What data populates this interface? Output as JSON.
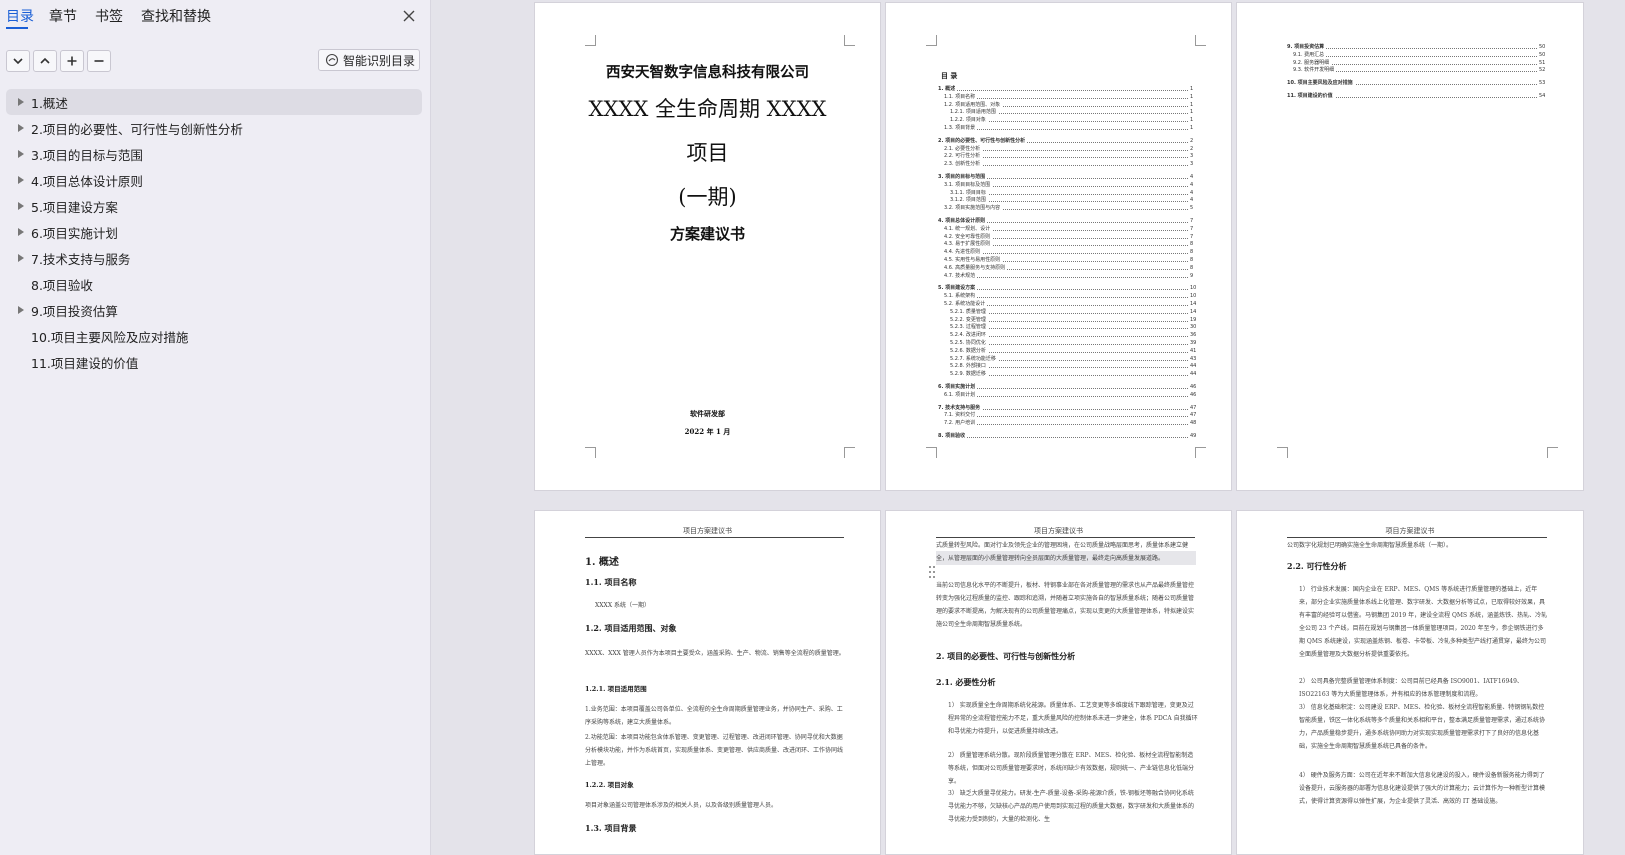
{
  "sidebar": {
    "tabs": [
      {
        "label": "目录",
        "active": true
      },
      {
        "label": "章节",
        "active": false
      },
      {
        "label": "书签",
        "active": false
      },
      {
        "label": "查找和替换",
        "active": false
      }
    ],
    "toolbar": {
      "smart_label": "智能识别目录"
    },
    "toc": [
      {
        "label": "1.概述",
        "expandable": true,
        "active": true
      },
      {
        "label": "2.项目的必要性、可行性与创新性分析",
        "expandable": true,
        "active": false
      },
      {
        "label": "3.项目的目标与范围",
        "expandable": true,
        "active": false
      },
      {
        "label": "4.项目总体设计原则",
        "expandable": true,
        "active": false
      },
      {
        "label": "5.项目建设方案",
        "expandable": true,
        "active": false
      },
      {
        "label": "6.项目实施计划",
        "expandable": true,
        "active": false
      },
      {
        "label": "7.技术支持与服务",
        "expandable": true,
        "active": false
      },
      {
        "label": "8.项目验收",
        "expandable": false,
        "active": false
      },
      {
        "label": "9.项目投资估算",
        "expandable": true,
        "active": false
      },
      {
        "label": "10.项目主要风险及应对措施",
        "expandable": false,
        "active": false
      },
      {
        "label": "11.项目建设的价值",
        "expandable": false,
        "active": false
      }
    ]
  },
  "cover": {
    "company": "西安天智数字信息科技有限公司",
    "title_line1": "XXXX 全生命周期 XXXX",
    "title_line2": "项目",
    "title_line3": "(一期)",
    "subtitle": "方案建议书",
    "dept": "软件研发部",
    "date": "2022 年 1 月"
  },
  "toc_page": {
    "title": "目  录",
    "entries": [
      {
        "label": "1.  概述",
        "page": "1",
        "level": 0
      },
      {
        "label": "1.1.  项目名称",
        "page": "1",
        "level": 1
      },
      {
        "label": "1.2.  项目适用范围、对象",
        "page": "1",
        "level": 1
      },
      {
        "label": "1.2.1.  项目适用范围",
        "page": "1",
        "level": 2
      },
      {
        "label": "1.2.2.  项目对象",
        "page": "1",
        "level": 2
      },
      {
        "label": "1.3.  项目背景",
        "page": "1",
        "level": 1
      },
      {
        "label": "2.  项目的必要性、可行性与创新性分析",
        "page": "2",
        "level": 0
      },
      {
        "label": "2.1.  必要性分析",
        "page": "2",
        "level": 1
      },
      {
        "label": "2.2.  可行性分析",
        "page": "3",
        "level": 1
      },
      {
        "label": "2.3.  创新性分析",
        "page": "3",
        "level": 1
      },
      {
        "label": "3.  项目的目标与范围",
        "page": "4",
        "level": 0
      },
      {
        "label": "3.1.  项目目标及范围",
        "page": "4",
        "level": 1
      },
      {
        "label": "3.1.1.  项目目标",
        "page": "4",
        "level": 2
      },
      {
        "label": "3.1.2.  项目范围",
        "page": "4",
        "level": 2
      },
      {
        "label": "3.2.  项目实施范围与内容",
        "page": "5",
        "level": 1
      },
      {
        "label": "4.  项目总体设计原则",
        "page": "7",
        "level": 0
      },
      {
        "label": "4.1.  统一规划、设计",
        "page": "7",
        "level": 1
      },
      {
        "label": "4.2.  安全可靠性原则",
        "page": "7",
        "level": 1
      },
      {
        "label": "4.3.  易于扩展性原则",
        "page": "8",
        "level": 1
      },
      {
        "label": "4.4.  先进性原则",
        "page": "8",
        "level": 1
      },
      {
        "label": "4.5.  实用性与易用性原则",
        "page": "8",
        "level": 1
      },
      {
        "label": "4.6.  高质量服务与支持原则",
        "page": "8",
        "level": 1
      },
      {
        "label": "4.7.  技术规范",
        "page": "9",
        "level": 1
      },
      {
        "label": "5.  项目建设方案",
        "page": "10",
        "level": 0
      },
      {
        "label": "5.1.  系统架构",
        "page": "10",
        "level": 1
      },
      {
        "label": "5.2.  系统功能设计",
        "page": "14",
        "level": 1
      },
      {
        "label": "5.2.1.  质量管理",
        "page": "14",
        "level": 2
      },
      {
        "label": "5.2.2.  变更管理",
        "page": "19",
        "level": 2
      },
      {
        "label": "5.2.3.  过程管理",
        "page": "30",
        "level": 2
      },
      {
        "label": "5.2.4.  改进闭环",
        "page": "36",
        "level": 2
      },
      {
        "label": "5.2.5.  协同优化",
        "page": "39",
        "level": 2
      },
      {
        "label": "5.2.6.  数据分析",
        "page": "41",
        "level": 2
      },
      {
        "label": "5.2.7.  系统功能迁移",
        "page": "43",
        "level": 2
      },
      {
        "label": "5.2.8.  外部接口",
        "page": "44",
        "level": 2
      },
      {
        "label": "5.2.9.  数据迁移",
        "page": "44",
        "level": 2
      },
      {
        "label": "6.  项目实施计划",
        "page": "46",
        "level": 0
      },
      {
        "label": "6.1.  项目计划",
        "page": "46",
        "level": 1
      },
      {
        "label": "7.  技术支持与服务",
        "page": "47",
        "level": 0
      },
      {
        "label": "7.1.  资料交付",
        "page": "47",
        "level": 1
      },
      {
        "label": "7.2.  用户培训",
        "page": "48",
        "level": 1
      },
      {
        "label": "8.  项目验收",
        "page": "49",
        "level": 0
      }
    ]
  },
  "toc_page2": {
    "entries": [
      {
        "label": "9.  项目投资估算",
        "page": "50",
        "level": 0
      },
      {
        "label": "9.1.  费用汇总",
        "page": "50",
        "level": 1
      },
      {
        "label": "9.2.  服务器明细",
        "page": "51",
        "level": 1
      },
      {
        "label": "9.3.  软件开发明细",
        "page": "52",
        "level": 1
      },
      {
        "label": "10.  项目主要风险及应对措施",
        "page": "53",
        "level": 0
      },
      {
        "label": "11.  项目建设的价值",
        "page": "54",
        "level": 0
      }
    ]
  },
  "body_pages": {
    "header": "项目方案建议书",
    "page4": {
      "h_overview": "1.  概述",
      "h_name": "1.1.  项目名称",
      "p_name": "XXXX 系统（一期）",
      "h_scope": "1.2.  项目适用范围、对象",
      "p_scope": "XXXX、XXX 管理人员作为本项目主要受众，涵盖采购、生产、物流、销售等全流程的质量管理。",
      "h_scope_range": "1.2.1.  项目适用范围",
      "p_range1": "1.业务范围：本项目覆盖公司各单位、全流程的全生命周期质量管理业务，并协同生产、采购、工序采购等系统，建立大质量体系。",
      "p_range2": "2.功能范围：本项目功能包含体系管理、变更管理、过程管理、改进闭环管理、协同寻优和大数据分析模块功能，并作为系统首页，实现质量体系、变更管理、供应商质量、改进闭环、工作协同线上管理。",
      "h_object": "1.2.2.  项目对象",
      "p_object": "项目对象涵盖公司管理体系涉及的相关人员，以及各级别质量管理人员。",
      "h_background": "1.3.  项目背景"
    },
    "page5": {
      "p_intro": "式质量转型风险。面对行业及领先企业的管理困境，在公司质量战略层面思考，质量体系建立健全，从管理层面的小质量管理转向全员层面的大质量管理，最终走向高质量发展道路。",
      "p_current": "当前公司信息化水平的不断提升，板材、特钢事业部在各对质量管理的需求也从产品最终质量管控转变为强化过程质量的监控、跟踪和追溯，并随着立项实施各自的智慧质量系统；随着公司质量管理的要求不断提高，为解决现有的公司质量管理痛点，实现以变更的大质量管理体系，特拟建设实施公司全生命周期智慧质量系统。",
      "h_section2": "2.  项目的必要性、可行性与创新性分析",
      "h_necessity": "2.1.  必要性分析",
      "items": [
        "1） 实现质量全生命周期系统化能源。质量体系、工艺变更等多维度线下跟踪管理，变更及过程异常的全流程管控能力不足，重大质量风险的控制体系未进一步建全，体系 PDCA 自我循环和寻优能力待提升，以促进质量持续改进。",
        "2） 质量管理系统分散。现阶段质量管理分散在 ERP、MES、检化验、板材全流程智能制造等系统，但面对公司质量管理要求时，系统间缺少有效数据，规则统一、产业链信息化低端分享。",
        "3） 缺乏大质量寻优能力。研发-生产-质量-设备-采购-能源介质，铁-钢板坯等融合协同化系统寻优能力不够，欠缺核心产品的用户使用到实现过程的质量大数据，数字研发和大质量体系的寻优能力受到制约，大量的检测化、生"
      ]
    },
    "page6": {
      "p_top": "公司数字化规划已明确实施全生命周期智慧质量系统（一期）。",
      "h_feasibility": "2.2.  可行性分析",
      "items": [
        "1） 行业技术发展：国内企业在 ERP、MES、QMS 等系统进行质量管理的基础上，近年来，部分企业实施质量体系线上化管理、数字研发、大数据分析等试点，已取得较好效果，具有丰富的经验可以借鉴。马钢集团 2019 年，建设全流程 QMS 系统，涵盖炼铁、热轧、冷轧全公司 23 个产线，目前在规划与钢集团一体质量管理项目，2020 年至今，参企钢铁进行多期 QMS 系统建设，实现涵盖炼钢、板卷、卡带板、冷轧多种类型产线打通贯穿，最终为公司全面质量管理及大数据分析提供重要依托。",
        "2） 公司具备完整质量管理体系制度：公司目前已经具备 ISO9001、IATF16949、ISO22163 等为大质量管理体系，并有相应的体系管理制度和流程。",
        "3） 信息化基础积淀：公司建设 ERP、MES、检化验、板材全流程智能质量、特钢钢轧数控智能质量，铁区一体化系统等多个质量和关系相和平台，整本满足质量管理需求，通过系统协力，产品质量稳步提升，通多系统协同助力对实现实现质量管理需求打下了良好的信息化基础，实施全生命周期智慧质量系统已具备的条件。",
        "4） 硬件及服务方面：公司在近年来不断加大信息化建设的投入，硬件设备新服务能力得到了设备提升，云服务器的部署为信息化建设提供了强大的计算能力；云计算作为一种新型计算模式，使得计算资源得以弹性扩展，为企业提供了灵活、高效的 IT 基础设施。"
      ]
    }
  },
  "colors": {
    "accent": "#1b5fd6",
    "sidebar_bg": "#eeedf4",
    "canvas_bg": "#e4e3ea"
  }
}
